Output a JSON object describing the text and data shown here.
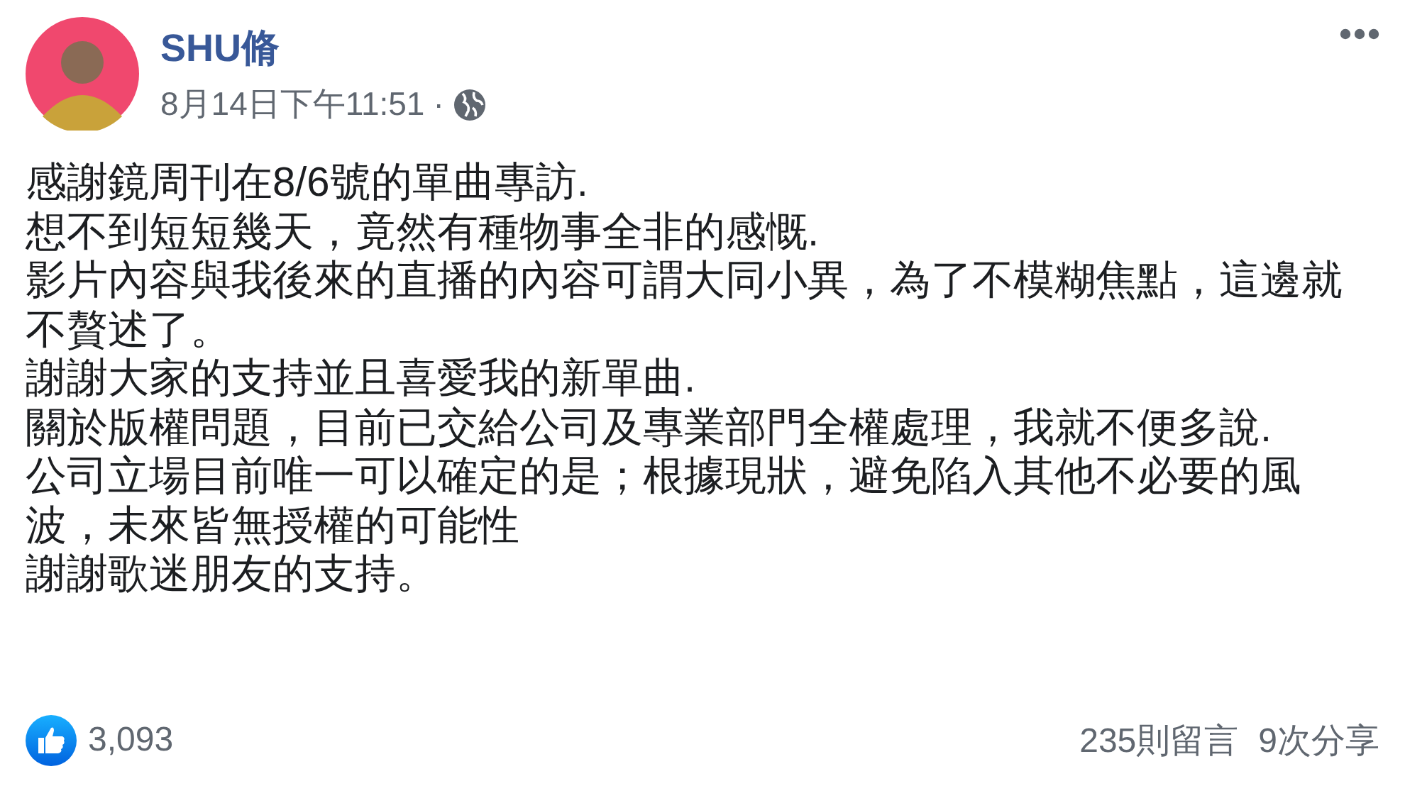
{
  "post": {
    "author": "SHU脩",
    "timestamp": "8月14日下午11:51",
    "separator": "·",
    "body": [
      "感謝鏡周刊在8/6號的單曲專訪.",
      "想不到短短幾天，竟然有種物事全非的感慨.",
      "影片內容與我後來的直播的內容可謂大同小異，為了不模糊焦點，這邊就不贅述了。",
      "謝謝大家的支持並且喜愛我的新單曲.",
      "關於版權問題，目前已交給公司及專業部門全權處理，我就不便多說.",
      "公司立場目前唯一可以確定的是；根據現狀，避免陷入其他不必要的風波，未來皆無授權的可能性",
      "謝謝歌迷朋友的支持。"
    ],
    "reactions": {
      "likes": "3,093",
      "comments": "235則留言",
      "shares": "9次分享"
    }
  }
}
